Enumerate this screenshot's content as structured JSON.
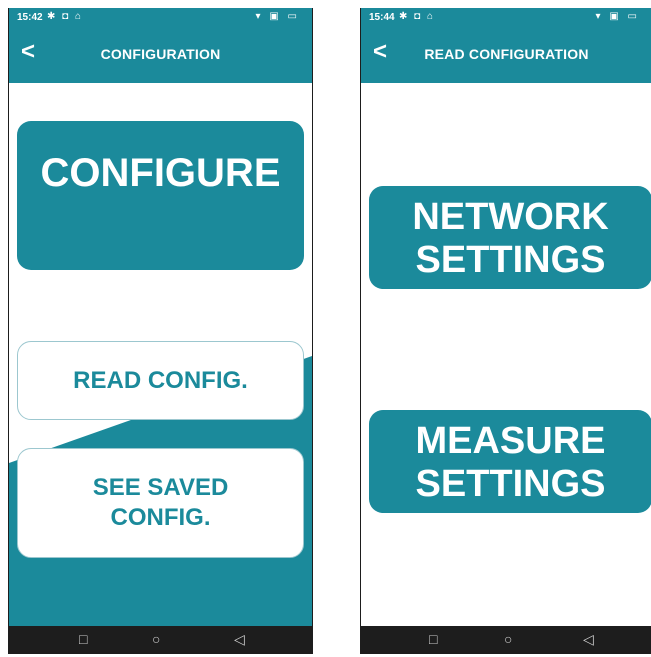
{
  "left_screen": {
    "status": {
      "time": "15:42",
      "left_icons": "✱ ◘ ⌂",
      "right_icons": "▾ ▣ ▭"
    },
    "appbar": {
      "back_icon": "chevron-left-icon",
      "back_glyph": "<",
      "title": "CONFIGURATION"
    },
    "buttons": {
      "configure": "CONFIGURE",
      "read_config": "READ CONFIG.",
      "see_saved_line1": "SEE SAVED",
      "see_saved_line2": "CONFIG."
    },
    "navbar": {
      "square": "□",
      "circle": "○",
      "back": "◁"
    }
  },
  "right_screen": {
    "status": {
      "time": "15:44",
      "left_icons": "✱ ◘ ⌂",
      "right_icons": "▾ ▣ ▭"
    },
    "appbar": {
      "back_icon": "chevron-left-icon",
      "back_glyph": "<",
      "title": "READ CONFIGURATION"
    },
    "buttons": {
      "network_line1": "NETWORK",
      "network_line2": "SETTINGS",
      "measure_line1": "MEASURE",
      "measure_line2": "SETTINGS"
    },
    "navbar": {
      "square": "□",
      "circle": "○",
      "back": "◁"
    }
  },
  "colors": {
    "teal": "#1b8a9b",
    "navbar": "#1d1d1d",
    "white": "#ffffff"
  }
}
